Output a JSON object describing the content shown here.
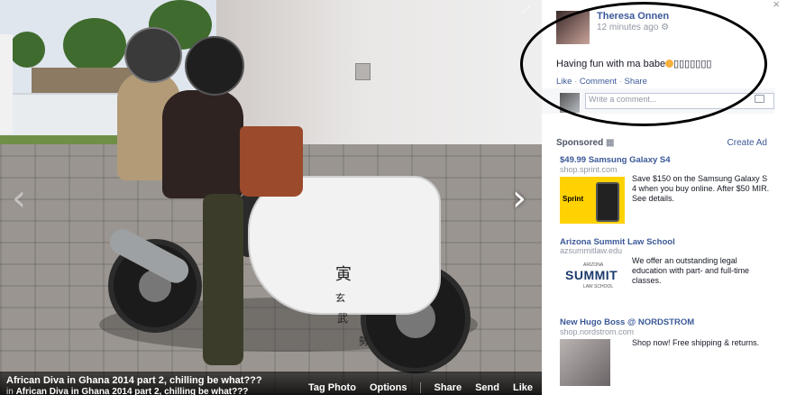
{
  "photo": {
    "kanji": [
      "寅",
      "玄",
      "武",
      "勢"
    ],
    "caption_title": "African Diva in Ghana 2014 part 2, chilling be what???",
    "caption_in_prefix": "in",
    "caption_album": "African Diva in Ghana 2014 part 2, chilling be what???",
    "actions": {
      "tag_photo": "Tag Photo",
      "options": "Options",
      "share": "Share",
      "send": "Send",
      "like": "Like"
    },
    "prev_icon": "‹",
    "next_icon": "›",
    "expand_icon": "⤢"
  },
  "post": {
    "close_icon": "×",
    "author": "Theresa Onnen",
    "timestamp": "12 minutes ago",
    "status_text": "Having fun with ma babe",
    "status_tail": "▯▯▯▯▯▯▯",
    "actions": {
      "like": "Like",
      "comment": "Comment",
      "share": "Share",
      "sep": "·"
    },
    "comment_placeholder": "Write a comment..."
  },
  "ads": {
    "sponsored_label": "Sponsored",
    "create_ad": "Create Ad",
    "items": [
      {
        "title": "$49.99 Samsung Galaxy S4",
        "url": "shop.sprint.com",
        "body": "Save $150 on the Samsung Galaxy S 4 when you buy online. After $50 MIR. See details.",
        "logo": "Sprint"
      },
      {
        "title": "Arizona Summit Law School",
        "url": "azsummitlaw.edu",
        "body": "We offer an outstanding legal education with part- and full-time classes.",
        "logo": "SUMMIT",
        "logo_top": "ARIZONA",
        "logo_bottom": "LAW SCHOOL"
      },
      {
        "title": "New Hugo Boss @ NORDSTROM",
        "url": "shop.nordstrom.com",
        "body": "Shop now! Free shipping & returns."
      }
    ]
  }
}
